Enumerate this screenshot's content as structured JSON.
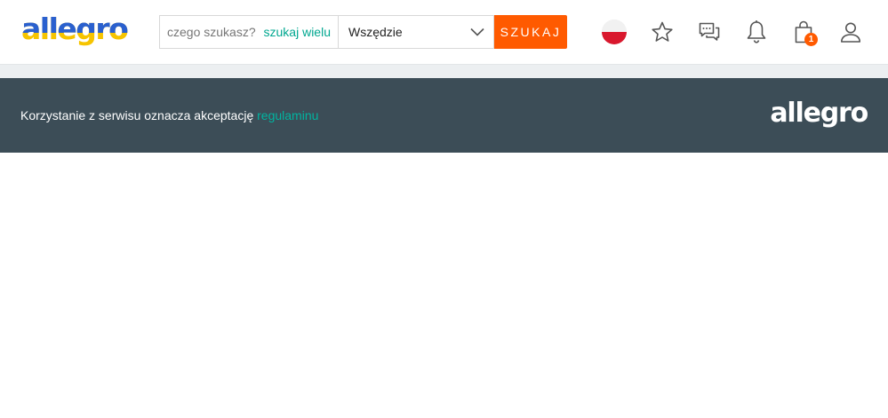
{
  "header": {
    "logo_text": "allegro",
    "search": {
      "placeholder": "czego szukasz?",
      "value": "",
      "search_many_link": "szukaj wielu",
      "category_selected": "Wszędzie",
      "button_label": "SZUKAJ"
    },
    "icons": {
      "language": "poland-flag-icon",
      "favorites": "star-icon",
      "messages": "chat-bubbles-icon",
      "notifications": "bell-icon",
      "cart": "shopping-bag-icon",
      "account": "user-icon"
    },
    "cart_count": "1"
  },
  "banner": {
    "text": "Korzystanie z serwisu oznacza akceptację ",
    "link_text": "regulaminu",
    "logo_text": "allegro"
  },
  "colors": {
    "accent_orange": "#ff5a00",
    "link_teal": "#00a790",
    "banner_bg": "#3c4d57",
    "logo_blue": "#2a60cf",
    "logo_yellow": "#f6c400",
    "flag_red": "#d9182d"
  }
}
